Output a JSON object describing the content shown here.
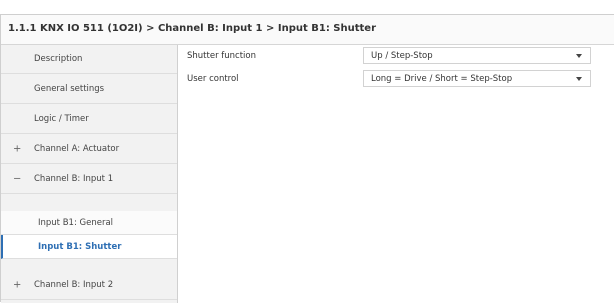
{
  "page": {
    "heading_ghost": ""
  },
  "breadcrumb": "1.1.1 KNX IO 511 (1O2I) > Channel B: Input 1 > Input B1: Shutter",
  "sidebar": {
    "items": [
      {
        "label": "Description",
        "prefix": ""
      },
      {
        "label": "General settings",
        "prefix": ""
      },
      {
        "label": "Logic / Timer",
        "prefix": ""
      },
      {
        "label": "Channel A: Actuator",
        "prefix": "+"
      },
      {
        "label": "Channel B: Input 1",
        "prefix": "−"
      },
      {
        "label": "Input B1: General",
        "prefix": ""
      },
      {
        "label": "Input B1: Shutter",
        "prefix": ""
      },
      {
        "label": "Channel B: Input 2",
        "prefix": "+"
      }
    ],
    "active_index": 6
  },
  "parameters": [
    {
      "label": "Shutter function",
      "value": "Up / Step-Stop"
    },
    {
      "label": "User control",
      "value": "Long = Drive / Short = Step-Stop"
    }
  ],
  "colors": {
    "accent": "#2e6fb4",
    "sidebar_bg": "#f2f2f2"
  },
  "icons": {
    "expand": "plus-icon",
    "collapse": "minus-icon",
    "dropdown": "caret-down-icon"
  }
}
